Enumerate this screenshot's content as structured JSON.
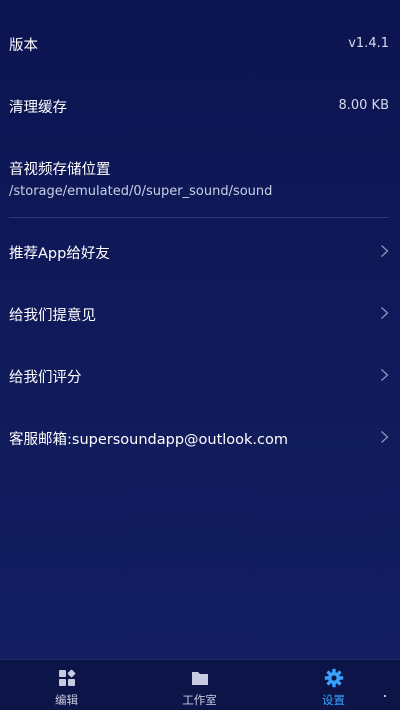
{
  "settings": {
    "version": {
      "label": "版本",
      "value": "v1.4.1"
    },
    "clear_cache": {
      "label": "清理缓存",
      "value": "8.00 KB"
    },
    "storage": {
      "label": "音视频存储位置",
      "path": "/storage/emulated/0/super_sound/sound"
    },
    "recommend": {
      "label": "推荐App给好友"
    },
    "feedback": {
      "label": "给我们提意见"
    },
    "rate": {
      "label": "给我们评分"
    },
    "support_email": {
      "label": "客服邮箱:supersoundapp@outlook.com"
    }
  },
  "tabs": [
    {
      "label": "编辑",
      "icon": "edit-grid-icon",
      "active": false
    },
    {
      "label": "工作室",
      "icon": "folder-icon",
      "active": false
    },
    {
      "label": "设置",
      "icon": "gear-icon",
      "active": true
    }
  ],
  "colors": {
    "background": "#0f1854",
    "tab_active": "#3aa0ff",
    "tab_inactive": "#c8cbe0"
  }
}
